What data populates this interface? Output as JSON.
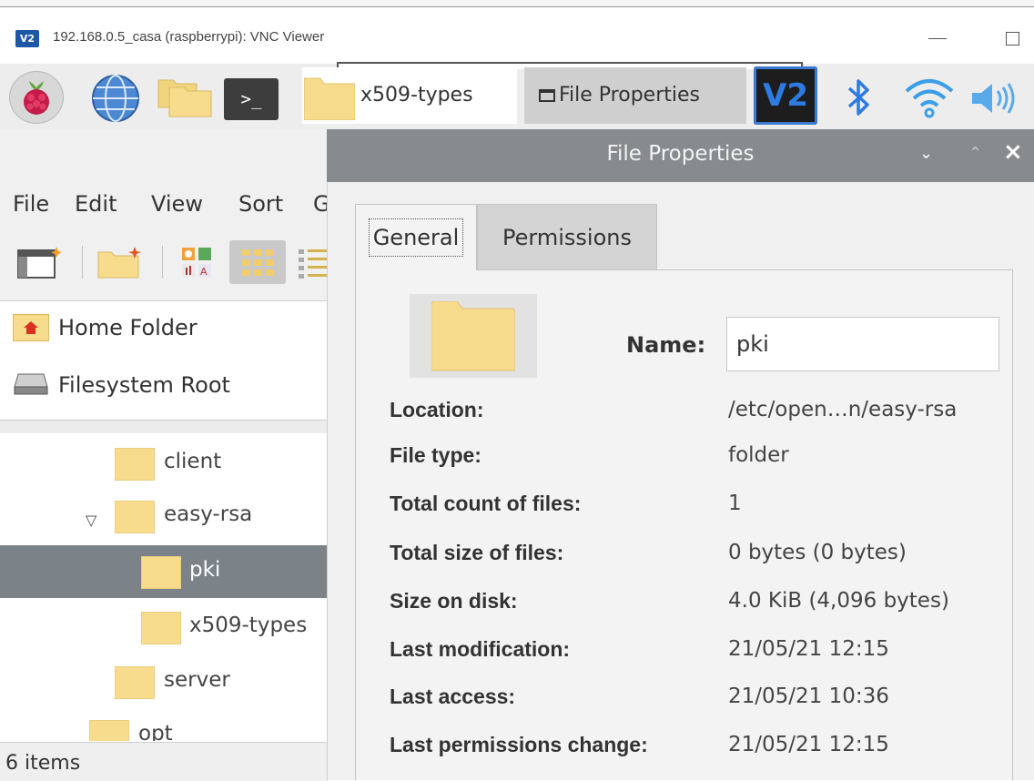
{
  "vnc_window": {
    "logo_text": "V2",
    "title": "192.168.0.5_casa (raspberrypi): VNC Viewer"
  },
  "taskbar": {
    "terminal_glyph": ">_",
    "tasks": [
      {
        "label": "x509-types"
      },
      {
        "label": "File Properties"
      }
    ],
    "vnc_tray_text": "V2"
  },
  "file_manager": {
    "menu": [
      "File",
      "Edit",
      "View",
      "Sort",
      "G"
    ],
    "places": [
      {
        "label": "Home Folder",
        "icon": "home-icon"
      },
      {
        "label": "Filesystem Root",
        "icon": "drive-icon"
      }
    ],
    "tree": [
      {
        "label": "client",
        "selected": false
      },
      {
        "label": "easy-rsa",
        "selected": false,
        "expanded": true
      },
      {
        "label": "pki",
        "selected": true
      },
      {
        "label": "x509-types",
        "selected": false
      },
      {
        "label": "server",
        "selected": false
      },
      {
        "label": "opt",
        "selected": false
      }
    ],
    "status": "6 items"
  },
  "dialog": {
    "title": "File Properties",
    "tabs": [
      "General",
      "Permissions"
    ],
    "active_tab": "General",
    "name_label": "Name:",
    "name_value": "pki",
    "properties": [
      {
        "label": "Location:",
        "value": "/etc/open…n/easy-rsa"
      },
      {
        "label": "File type:",
        "value": "folder"
      },
      {
        "label": "Total count of files:",
        "value": "1"
      },
      {
        "label": "Total size of files:",
        "value": "0 bytes (0 bytes)"
      },
      {
        "label": "Size on disk:",
        "value": "4.0 KiB (4,096 bytes)"
      },
      {
        "label": "Last modification:",
        "value": "21/05/21 12:15"
      },
      {
        "label": "Last access:",
        "value": "21/05/21 10:36"
      },
      {
        "label": "Last permissions change:",
        "value": "21/05/21 12:15"
      }
    ]
  },
  "colors": {
    "folder": "#f6dc8c",
    "folder_edge": "#e0c070",
    "selection": "#7b8389",
    "dialog_title": "#878b8e",
    "vnc_blue": "#1d58a7",
    "tray_blue": "#2d7be0"
  }
}
